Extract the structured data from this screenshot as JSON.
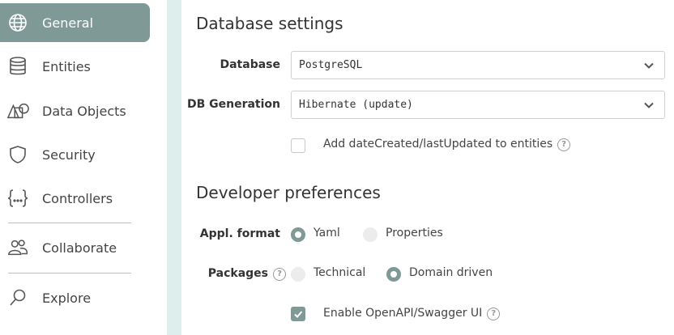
{
  "sidebar": {
    "items": [
      {
        "label": "General",
        "icon": "globe-icon",
        "active": true
      },
      {
        "label": "Entities",
        "icon": "database-icon"
      },
      {
        "label": "Data Objects",
        "icon": "shapes-icon"
      },
      {
        "label": "Security",
        "icon": "shield-icon"
      },
      {
        "label": "Controllers",
        "icon": "braces-icon"
      },
      {
        "label": "Collaborate",
        "icon": "users-icon"
      },
      {
        "label": "Explore",
        "icon": "magnifier-icon"
      }
    ]
  },
  "database": {
    "title": "Database settings",
    "database_label": "Database",
    "database_value": "PostgreSQL",
    "generation_label": "DB Generation",
    "generation_value": "Hibernate (update)",
    "date_fields_label": "Add dateCreated/lastUpdated to entities",
    "date_fields_checked": false
  },
  "developer": {
    "title": "Developer preferences",
    "format_label": "Appl. format",
    "format_options": [
      {
        "label": "Yaml",
        "selected": true
      },
      {
        "label": "Properties",
        "selected": false
      }
    ],
    "packages_label": "Packages",
    "packages_options": [
      {
        "label": "Technical",
        "selected": false
      },
      {
        "label": "Domain driven",
        "selected": true
      }
    ],
    "openapi_label": "Enable OpenAPI/Swagger UI",
    "openapi_checked": true
  },
  "colors": {
    "accent": "#7f9996",
    "gutter": "#ddeeed"
  }
}
